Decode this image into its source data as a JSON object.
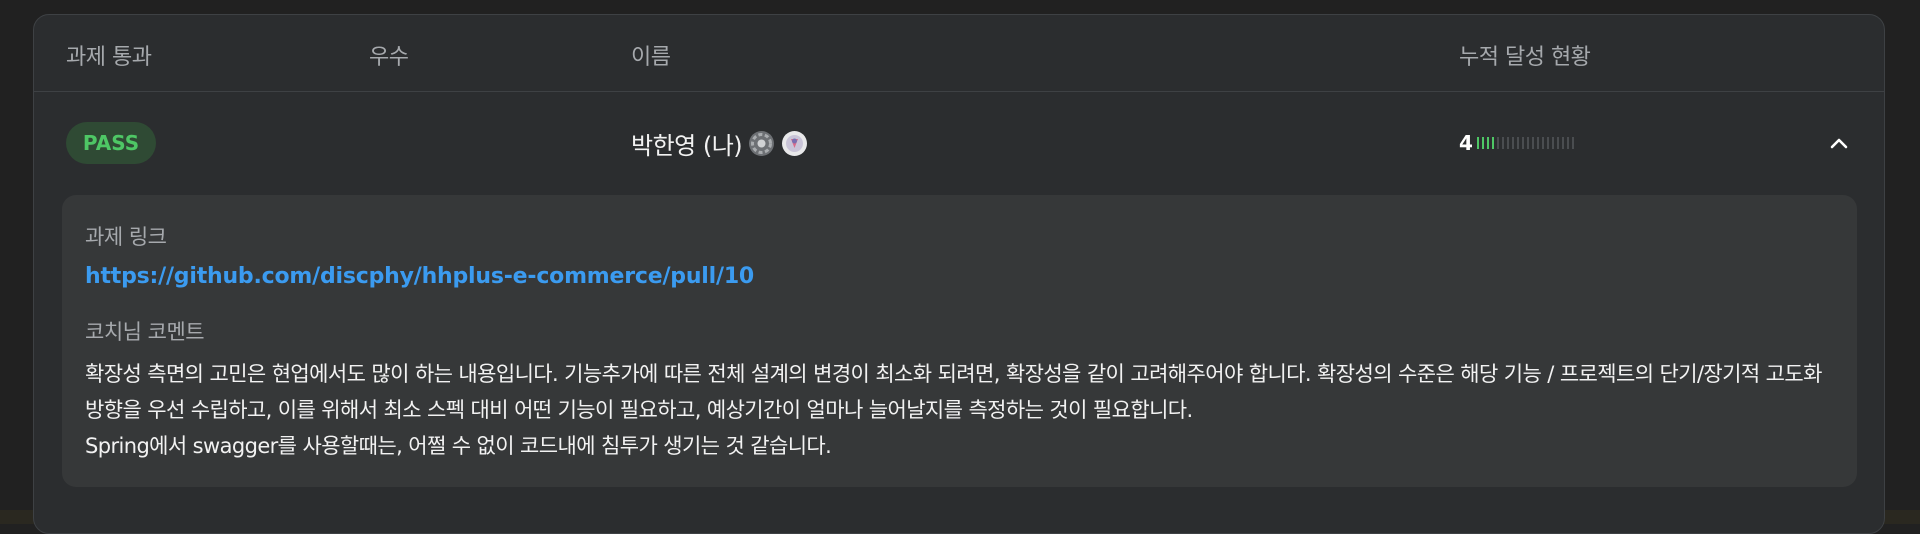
{
  "header": {
    "col_pass": "과제 통과",
    "col_excellent": "우수",
    "col_name": "이름",
    "col_progress": "누적 달성 현황"
  },
  "row": {
    "status": "PASS",
    "name": "박한영 (나)",
    "badges": [
      "gear-badge-icon",
      "medal-badge-icon"
    ],
    "progress": {
      "count": "4",
      "filled": 4,
      "total": 20
    }
  },
  "detail": {
    "link_label": "과제 링크",
    "link_url": "https://github.com/discphy/hhplus-e-commerce/pull/10",
    "comment_label": "코치님 코멘트",
    "comment_line1": "확장성 측면의 고민은 현업에서도 많이 하는 내용입니다. 기능추가에 따른 전체 설계의 변경이 최소화 되려면, 확장성을 같이 고려해주어야 합니다. 확장성의 수준은 해당 기능 / 프로젝트의 단기/장기적 고도화 방향을 우선 수립하고, 이를 위해서 최소 스펙 대비 어떤 기능이 필요하고, 예상기간이 얼마나 늘어날지를 측정하는 것이 필요합니다.",
    "comment_line2": "Spring에서 swagger를 사용할때는, 어쩔 수 없이 코드내에 침투가 생기는 것 같습니다."
  },
  "colors": {
    "accent_green": "#4ec765",
    "link_blue": "#3b9bf0",
    "card_bg": "#2b2d2f",
    "detail_bg": "#363839"
  }
}
